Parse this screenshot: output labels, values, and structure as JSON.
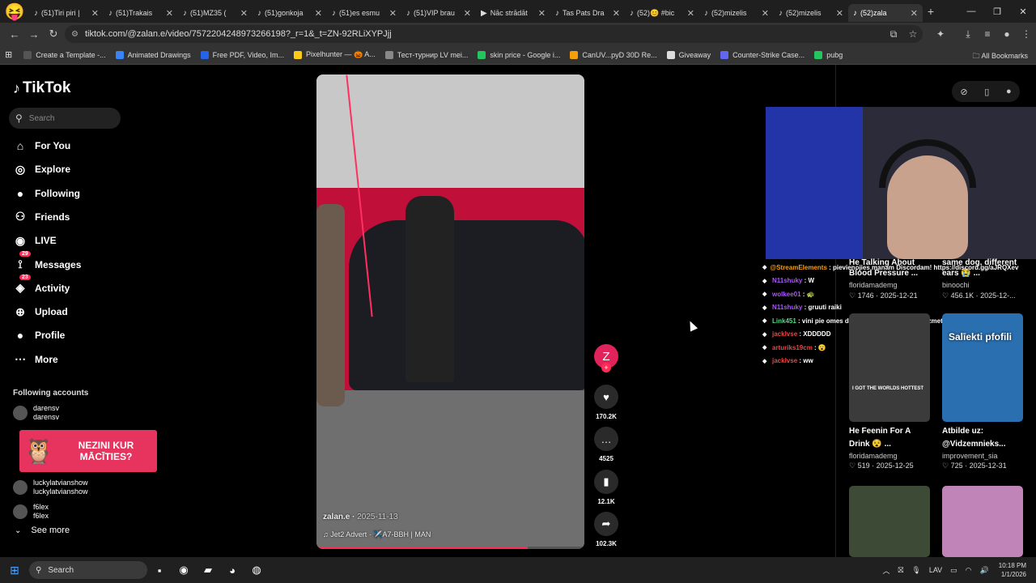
{
  "browser": {
    "tabs": [
      {
        "title": "(51)Tiri piri |",
        "icon": "tiktok-icon"
      },
      {
        "title": "(51)Trakais",
        "icon": "tiktok-icon"
      },
      {
        "title": "(51)MZ35 (",
        "icon": "tiktok-icon"
      },
      {
        "title": "(51)gonkoja",
        "icon": "tiktok-icon"
      },
      {
        "title": "(51)es esmu",
        "icon": "tiktok-icon"
      },
      {
        "title": "(51)VIP brau",
        "icon": "tiktok-icon"
      },
      {
        "title": "Nāc strādāt",
        "icon": "youtube-icon"
      },
      {
        "title": "Tas Pats Dra",
        "icon": "tiktok-icon"
      },
      {
        "title": "(52)😊 #bic",
        "icon": "tiktok-icon"
      },
      {
        "title": "(52)mizelis",
        "icon": "tiktok-icon"
      },
      {
        "title": "(52)mizelis",
        "icon": "tiktok-icon"
      },
      {
        "title": "(52)zala",
        "icon": "tiktok-icon",
        "active": true
      }
    ],
    "url": "tiktok.com/@zalan.e/video/7572204248973266198?_r=1&_t=ZN-92RLiXYPJjj",
    "bookmarks": [
      {
        "label": "Create a Template -...",
        "color": "#555"
      },
      {
        "label": "Animated Drawings",
        "color": "#3b82f6"
      },
      {
        "label": "Free PDF, Video, Im...",
        "color": "#2563eb"
      },
      {
        "label": "Pixelhunter — 🎃 A...",
        "color": "#facc15"
      },
      {
        "label": "Тест-турнир LV mei...",
        "color": "#888"
      },
      {
        "label": "skin price - Google i...",
        "color": "#22c55e"
      },
      {
        "label": "CanUV...pyD 30D Re...",
        "color": "#f59e0b"
      },
      {
        "label": "Giveaway",
        "color": "#ddd"
      },
      {
        "label": "Counter-Strike Case...",
        "color": "#6366f1"
      },
      {
        "label": "pubg",
        "color": "#22c55e"
      }
    ],
    "all_bookmarks": "All Bookmarks"
  },
  "sidebar": {
    "logo": "TikTok",
    "search_placeholder": "Search",
    "nav": [
      {
        "label": "For You",
        "icon": "home-icon"
      },
      {
        "label": "Explore",
        "icon": "compass-icon"
      },
      {
        "label": "Following",
        "icon": "following-avatar-icon"
      },
      {
        "label": "Friends",
        "icon": "friends-icon"
      },
      {
        "label": "LIVE",
        "icon": "live-icon"
      },
      {
        "label": "Messages",
        "icon": "messages-icon",
        "badge": "29"
      },
      {
        "label": "Activity",
        "icon": "activity-icon",
        "badge": "23"
      },
      {
        "label": "Upload",
        "icon": "upload-icon"
      },
      {
        "label": "Profile",
        "icon": "profile-icon"
      },
      {
        "label": "More",
        "icon": "more-icon"
      }
    ],
    "following_header": "Following accounts",
    "accounts": [
      {
        "name": "darensv",
        "handle": "darensv"
      },
      {
        "name": "luckylatvianshow",
        "handle": "luckylatvianshow"
      },
      {
        "name": "f6lex",
        "handle": "f6lex"
      }
    ],
    "promo_text": "NEZINI KUR MĀCĪTIES?",
    "see_more": "See more"
  },
  "video": {
    "author": "zalan.e",
    "date": "2025-11-13",
    "music": "Jet2 Advert · ✈️A7-BBH | MAN",
    "progress": 0.79
  },
  "actions": {
    "avatar_letter": "Z",
    "likes": "170.2K",
    "comments": "4525",
    "saves": "12.1K",
    "shares": "102.3K"
  },
  "chat": [
    {
      "user": "@StreamElements",
      "text": "pievienojies manam Discordam! https://discord.gg/aJRQXev",
      "color": "#f59e0b"
    },
    {
      "user": "N11shuky",
      "text": "W",
      "color": "#a855f7"
    },
    {
      "user": "wolkee01",
      "text": "🐢",
      "color": "#a855f7"
    },
    {
      "user": "N11shuky",
      "text": "gruuti raiki",
      "color": "#a855f7"
    },
    {
      "user": "Link451",
      "text": "vini pie omes dzivo laukos jo vinu sieva izmeta no majas",
      "color": "#4ade80"
    },
    {
      "user": "jacklvse",
      "text": "XDDDDD",
      "color": "#ef4444"
    },
    {
      "user": "arturiks19cm",
      "text": "😮",
      "color": "#ef4444"
    },
    {
      "user": "jacklvse",
      "text": "ww",
      "color": "#ef4444"
    }
  ],
  "related": {
    "partial_left_title": "He Talking About Blood Pressure ...",
    "partial_left_user": "floridamademg",
    "partial_left_stats": "1746 · 2025-12-21",
    "partial_right_title": "same dog, different ears 😭 ...",
    "partial_right_user": "binoochi",
    "partial_right_stats": "456.1K · 2025-12-...",
    "cards": [
      {
        "title": "He Feenin For A Drink 😵 ...",
        "user": "floridamademg",
        "stats": "519 · 2025-12-25",
        "thumb_text": "I GOT THE WORLDS HOTTEST",
        "thumb_color": "#3b3b3b"
      },
      {
        "title": "Atbilde uz: @Vidzemnieks...",
        "user": "improvement_sia",
        "stats": "725 · 2025-12-31",
        "thumb_text": "Salīekti pfofili",
        "thumb_color": "#2a6fb0"
      }
    ]
  },
  "taskbar": {
    "search": "Search",
    "lang": "LAV",
    "time": "10:18 PM",
    "date": "1/1/2026"
  }
}
